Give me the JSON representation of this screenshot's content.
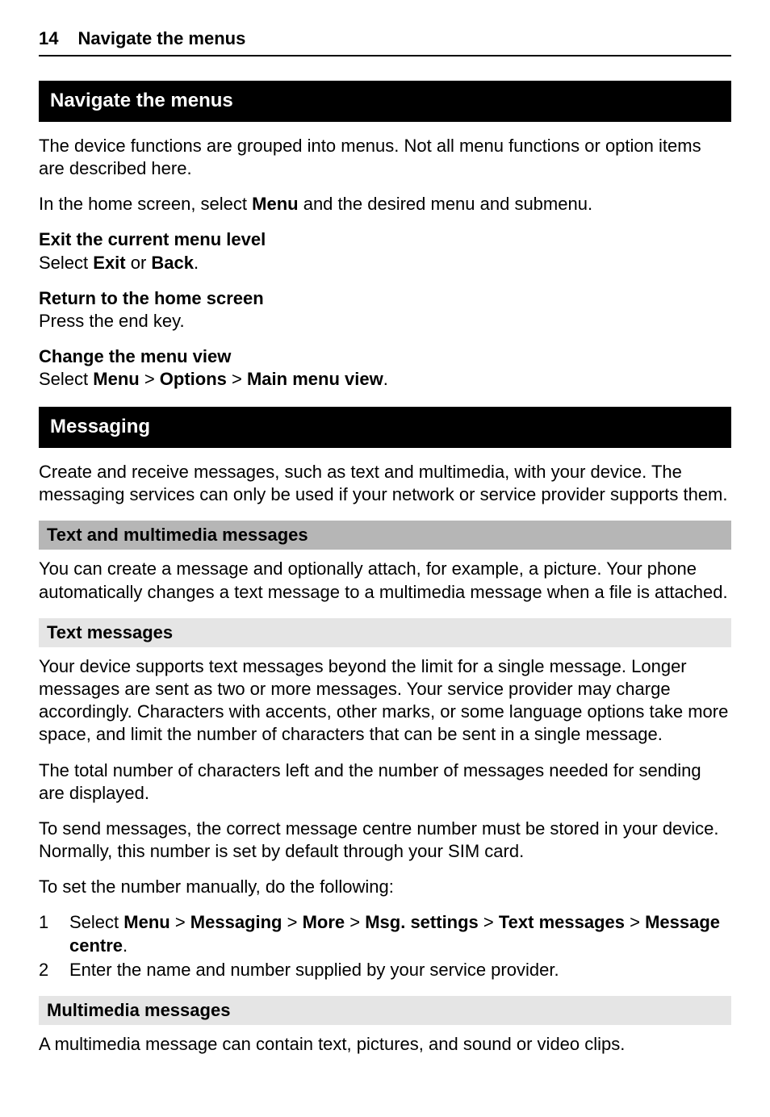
{
  "header": {
    "page_number": "14",
    "title": "Navigate the menus"
  },
  "sections": {
    "navigate": {
      "title": "Navigate the menus",
      "intro": "The device functions are grouped into menus. Not all menu functions or option items are described here.",
      "home_pre": "In the home screen, select ",
      "home_bold": "Menu",
      "home_post": " and the desired menu and submenu.",
      "exit_heading": "Exit the current menu level",
      "exit_pre": "Select ",
      "exit_b1": "Exit",
      "exit_mid": " or ",
      "exit_b2": "Back",
      "exit_post": ".",
      "return_heading": "Return to the home screen",
      "return_body": "Press the end key.",
      "change_heading": "Change the menu view",
      "change_pre": "Select ",
      "change_b1": "Menu",
      "change_sep1": " > ",
      "change_b2": "Options",
      "change_sep2": " > ",
      "change_b3": "Main menu view",
      "change_post": "."
    },
    "messaging": {
      "title": "Messaging",
      "intro": "Create and receive messages, such as text and multimedia, with your device. The messaging services can only be used if your network or service provider supports them.",
      "tmm_title": "Text and multimedia messages",
      "tmm_body": "You can create a message and optionally attach, for example, a picture. Your phone automatically changes a text message to a multimedia message when a file is attached.",
      "tm_title": "Text messages",
      "tm_p1": "Your device supports text messages beyond the limit for a single message. Longer messages are sent as two or more messages. Your service provider may charge accordingly. Characters with accents, other marks, or some language options take more space, and limit the number of characters that can be sent in a single message.",
      "tm_p2": "The total number of characters left and the number of messages needed for sending are displayed.",
      "tm_p3": "To send messages, the correct message centre number must be stored in your device. Normally, this number is set by default through your SIM card.",
      "tm_p4": "To set the number manually, do the following:",
      "step1": {
        "num": "1",
        "pre": "Select ",
        "b1": "Menu",
        "s1": " > ",
        "b2": "Messaging",
        "s2": " > ",
        "b3": "More",
        "s3": " > ",
        "b4": "Msg. settings",
        "s4": " > ",
        "b5": "Text messages",
        "s5": " > ",
        "b6": "Message centre",
        "post": "."
      },
      "step2": {
        "num": "2",
        "body": "Enter the name and number supplied by your service provider."
      },
      "mm_title": "Multimedia messages",
      "mm_body": "A multimedia message can contain text, pictures, and sound or video clips."
    }
  }
}
